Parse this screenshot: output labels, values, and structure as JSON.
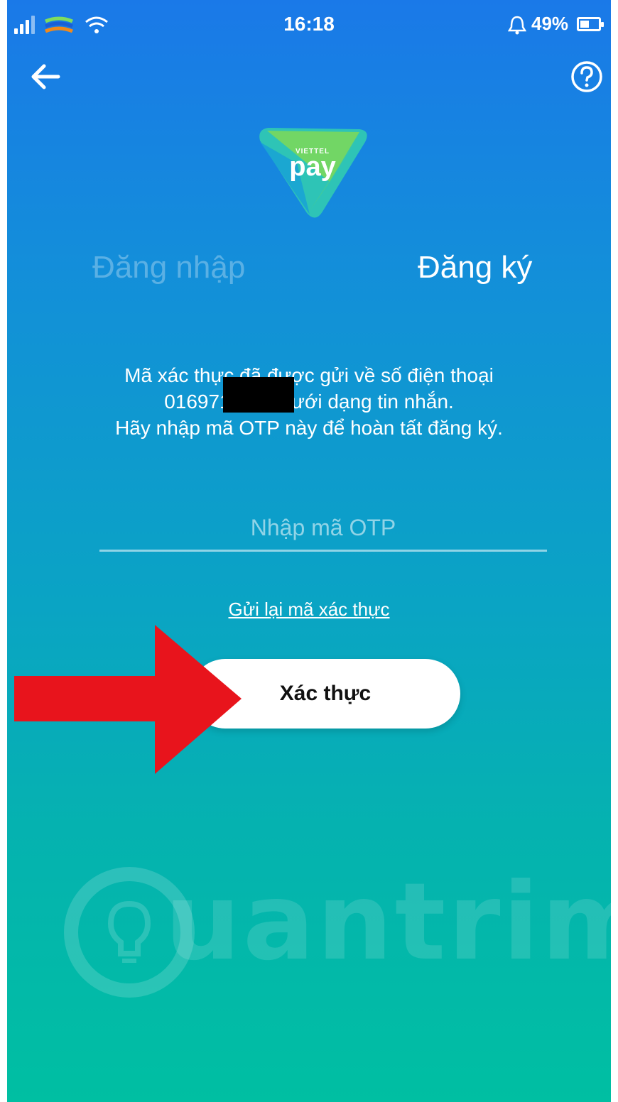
{
  "status_bar": {
    "time": "16:18",
    "battery_percent": "49%",
    "battery_level": 0.49,
    "icons": [
      "signal-icon",
      "carrier-icon",
      "wifi-icon",
      "alarm-icon",
      "battery-icon"
    ]
  },
  "header": {
    "back_icon": "arrow-left-icon",
    "help_icon": "question-circle-icon"
  },
  "logo": {
    "brand": "VIETTEL",
    "name": "pay"
  },
  "tabs": [
    {
      "label": "Đăng nhập",
      "active": false
    },
    {
      "label": "Đăng ký",
      "active": true
    }
  ],
  "message": {
    "line1": "Mã xác thực đã được gửi về số điện thoại",
    "line2": "016971         dưới dạng tin nhắn.",
    "line3": "Hãy nhập mã OTP này để hoàn tất đăng ký."
  },
  "otp_input": {
    "placeholder": "Nhập mã OTP",
    "value": ""
  },
  "resend_link": "Gửi lại mã xác thực",
  "verify_button": "Xác thực",
  "watermark": {
    "text": "uantrimang",
    "icon": "lightbulb-icon"
  },
  "colors": {
    "gradient_top": "#1a79e8",
    "gradient_bottom": "#00bfa2",
    "arrow": "#e8141c",
    "logo_green": "#7ed957",
    "logo_teal": "#2ec4b6"
  }
}
